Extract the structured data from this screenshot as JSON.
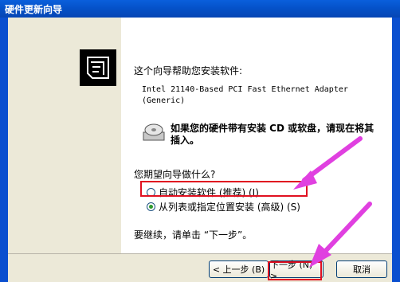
{
  "window": {
    "title": "硬件更新向导"
  },
  "content": {
    "intro": "这个向导帮助您安装软件:",
    "device_line1": "Intel 21140-Based PCI Fast Ethernet Adapter",
    "device_line2": "(Generic)",
    "cd_text": "如果您的硬件带有安装 CD 或软盘，请现在将其插入。",
    "question": "您期望向导做什么?",
    "options": [
      {
        "label": "自动安装软件 (推荐) (I)",
        "selected": false
      },
      {
        "label": "从列表或指定位置安装 (高级) (S)",
        "selected": true
      }
    ],
    "continue_hint": "要继续，请单击 “下一步”。"
  },
  "buttons": {
    "back": "< 上一步 (B)",
    "next": "下一步 (N) >",
    "cancel": "取消"
  },
  "colors": {
    "annotation_box": "#e01020",
    "annotation_arrow": "#e040e0",
    "titlebar": "#0552c9"
  },
  "icons": [
    "wizard-hardware-icon",
    "cd-drive-icon",
    "radio-icon",
    "arrow-annotation"
  ]
}
